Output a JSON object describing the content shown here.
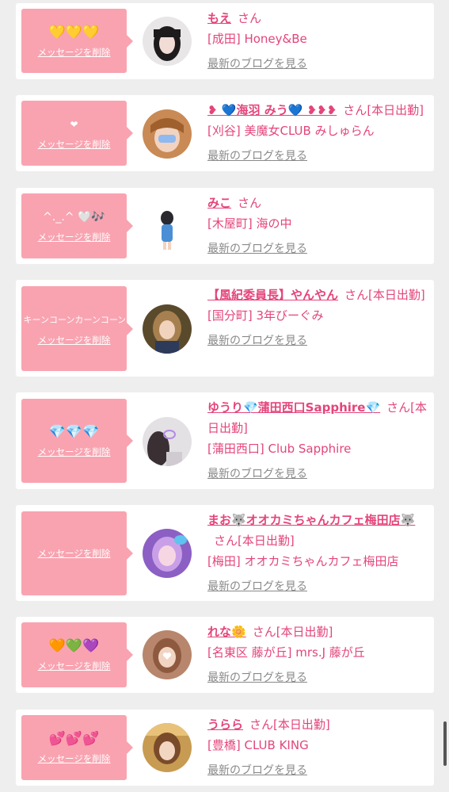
{
  "delete_label": "メッセージを削除",
  "blog_label": "最新のブログを見る",
  "san_label": "さん",
  "colors": {
    "bubble": "#f9a3b0",
    "accent": "#e4457a",
    "muted": "#8a8a8a"
  },
  "entries": [
    {
      "message": "💛💛💛",
      "name": "もえ",
      "status": "",
      "shop": "[成田] Honey&Be",
      "avatar_icon": "girl-photo"
    },
    {
      "message": "❤",
      "name": "❥ 💙海羽 みう💙 ❥❥❥",
      "status": "[本日出勤]",
      "shop": "[刈谷] 美魔女CLUB みしゅらん",
      "avatar_icon": "girl-photo"
    },
    {
      "message": "^._.^ 🤍🎶",
      "name": "みこ",
      "status": "",
      "shop": "[木屋町] 海の中",
      "avatar_icon": "girl-photo"
    },
    {
      "message": "キーンコーンカーンコーン🏫",
      "name": "【風紀委員長】やんやん",
      "status": "[本日出勤]",
      "shop": "[国分町] 3年びーぐみ",
      "avatar_icon": "girl-photo"
    },
    {
      "message": "💎💎💎",
      "name": "ゆうり💎蒲田西口Sapphire💎",
      "status": "[本日出勤]",
      "shop": "[蒲田西口] Club Sapphire",
      "avatar_icon": "girl-photo"
    },
    {
      "message": "",
      "name": "まお🐺オオカミちゃんカフェ梅田店🐺",
      "status": "[本日出勤]",
      "shop": "[梅田] オオカミちゃんカフェ梅田店",
      "avatar_icon": "girl-photo"
    },
    {
      "message": "🧡💚💜",
      "name": "れな🌼",
      "status": "[本日出勤]",
      "shop": "[名東区 藤が丘] mrs.J 藤が丘",
      "avatar_icon": "girl-photo"
    },
    {
      "message": "💕💕💕",
      "name": "うらら",
      "status": "[本日出勤]",
      "shop": "[豊橋] CLUB KING",
      "avatar_icon": "girl-photo"
    }
  ]
}
